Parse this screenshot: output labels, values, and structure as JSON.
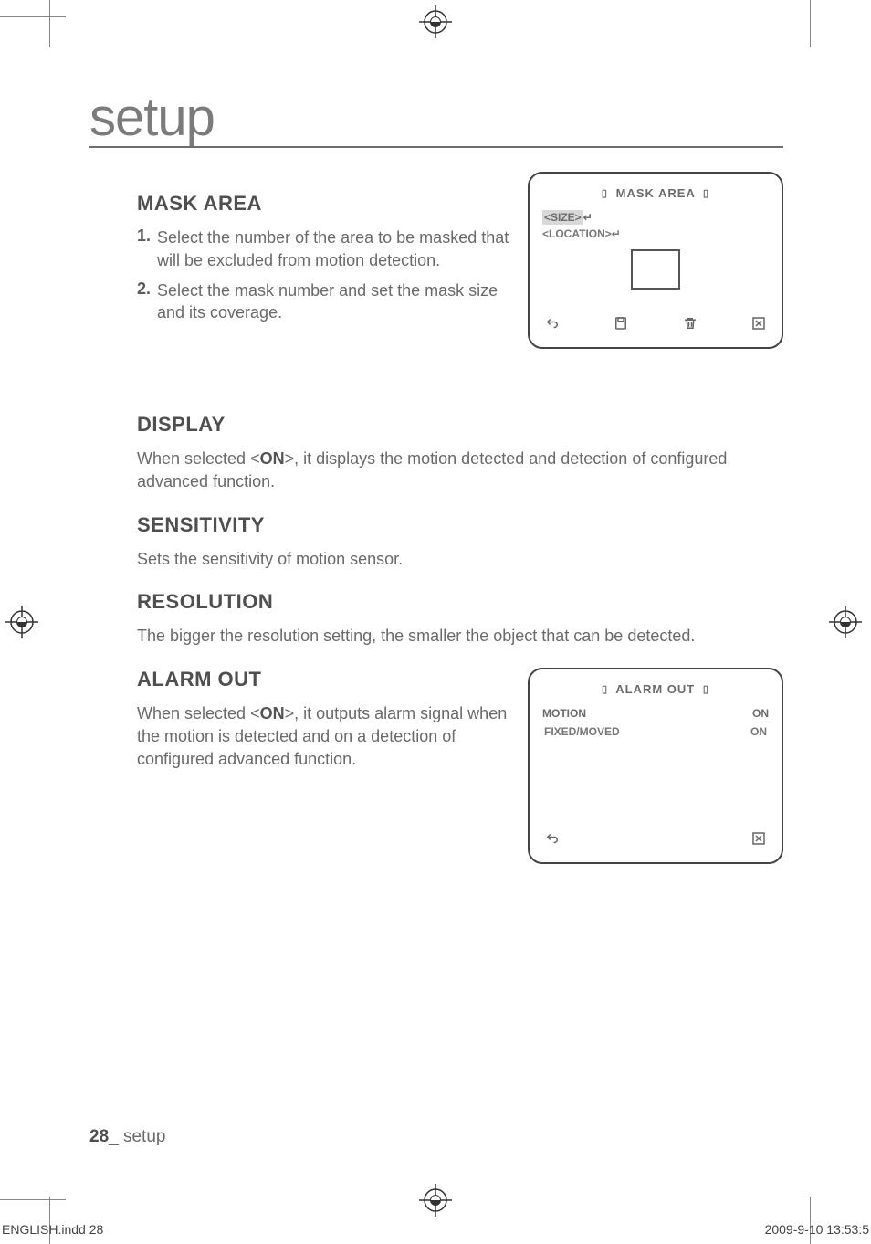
{
  "chapter": "setup",
  "mask_area": {
    "heading": "MASK AREA",
    "steps": [
      {
        "num": "1.",
        "text": "Select the number of the area to be masked that will be excluded from motion detection."
      },
      {
        "num": "2.",
        "text": "Select the mask number and set the mask size and its coverage."
      }
    ],
    "osd": {
      "title": "MASK AREA",
      "row_size": "<SIZE>",
      "row_location": "<LOCATION>"
    }
  },
  "display": {
    "heading": "DISPLAY",
    "pre": "When selected <",
    "on": "ON",
    "post": ">, it displays the motion detected and detection of configured advanced function."
  },
  "sensitivity": {
    "heading": "SENSITIVITY",
    "text": "Sets the sensitivity of motion sensor."
  },
  "resolution": {
    "heading": "RESOLUTION",
    "text": "The bigger the resolution setting, the smaller the object that can be detected."
  },
  "alarm_out": {
    "heading": "ALARM OUT",
    "pre": "When selected <",
    "on": "ON",
    "post": ">, it outputs alarm signal when the motion is detected and on a detection of configured advanced function.",
    "osd": {
      "title": "ALARM OUT",
      "rows": [
        {
          "label": "MOTION",
          "value": "ON"
        },
        {
          "label": "FIXED/MOVED",
          "value": "ON"
        }
      ]
    }
  },
  "footer": {
    "page_num": "28",
    "section": "_ setup"
  },
  "slug": {
    "left": "ENGLISH.indd   28",
    "right": "2009-9-10   13:53:5"
  }
}
